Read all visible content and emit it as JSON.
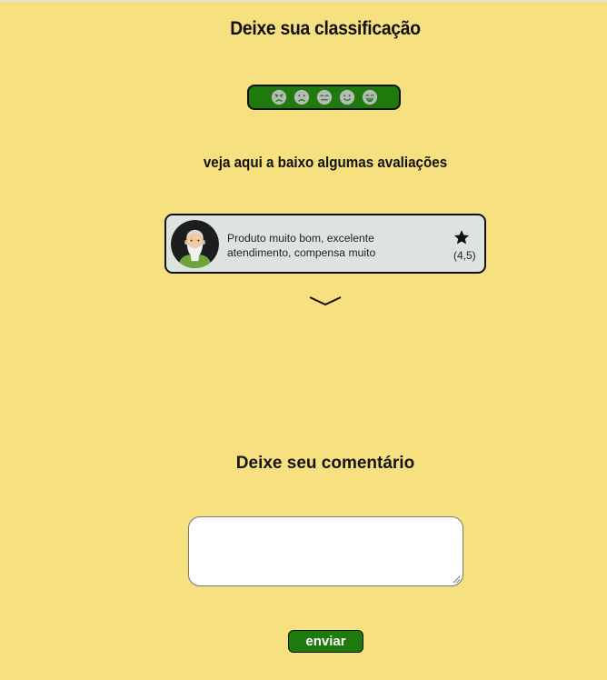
{
  "header": {
    "title": "Deixe sua classificação"
  },
  "rating": {
    "options": [
      {
        "icon": "angry-face-icon"
      },
      {
        "icon": "sad-face-icon"
      },
      {
        "icon": "neutral-face-icon"
      },
      {
        "icon": "smile-face-icon"
      },
      {
        "icon": "grin-face-icon"
      }
    ],
    "bar_color": "#1f7a0d",
    "face_color": "#b9b9b9"
  },
  "reviews": {
    "heading": "veja aqui a baixo algumas avaliações",
    "items": [
      {
        "avatar": "elderly-man-avatar",
        "text": "Produto muito bom, excelente atendimento, compensa muito",
        "star_icon": "star-icon",
        "score": "(4,5)"
      }
    ],
    "more_icon": "chevron-down-icon"
  },
  "comment": {
    "heading": "Deixe seu comentário",
    "value": "",
    "placeholder": "",
    "submit_label": "enviar"
  },
  "colors": {
    "background": "#f7e080",
    "card": "#dde3e1",
    "accent": "#1f7a0d"
  }
}
